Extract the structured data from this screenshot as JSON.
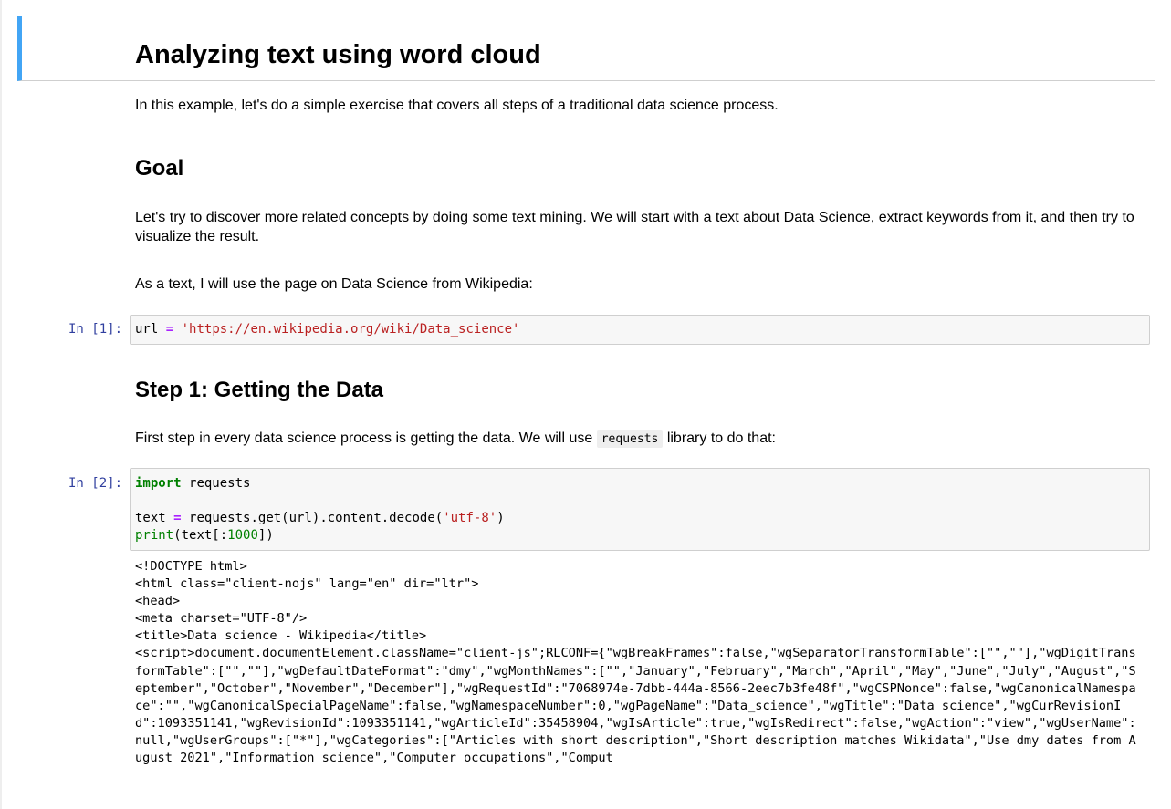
{
  "heading": "Analyzing text using word cloud",
  "intro": "In this example, let's do a simple exercise that covers all steps of a traditional data science process.",
  "goal": {
    "title": "Goal",
    "para1": "Let's try to discover more related concepts by doing some text mining. We will start with a text about Data Science, extract keywords from it, and then try to visualize the result.",
    "para2": "As a text, I will use the page on Data Science from Wikipedia:"
  },
  "cell1": {
    "prompt": "In [1]:",
    "var": "url",
    "op": "=",
    "value": "'https://en.wikipedia.org/wiki/Data_science'"
  },
  "step1": {
    "title": "Step 1: Getting the Data",
    "para_before": "First step in every data science process is getting the data. We will use",
    "inline_code": "requests",
    "para_after": "library to do that:"
  },
  "cell2": {
    "prompt": "In [2]:",
    "kw_import": "import",
    "module": "requests",
    "line2_var": "text",
    "line2_op": "=",
    "line2_call": "requests.get(url).content.decode(",
    "line2_str": "'utf-8'",
    "line2_close": ")",
    "line3_print": "print",
    "line3_a": "(text[:",
    "line3_num": "1000",
    "line3_b": "])",
    "output": "<!DOCTYPE html>\n<html class=\"client-nojs\" lang=\"en\" dir=\"ltr\">\n<head>\n<meta charset=\"UTF-8\"/>\n<title>Data science - Wikipedia</title>\n<script>document.documentElement.className=\"client-js\";RLCONF={\"wgBreakFrames\":false,\"wgSeparatorTransformTable\":[\"\",\"\"],\"wgDigitTransformTable\":[\"\",\"\"],\"wgDefaultDateFormat\":\"dmy\",\"wgMonthNames\":[\"\",\"January\",\"February\",\"March\",\"April\",\"May\",\"June\",\"July\",\"August\",\"September\",\"October\",\"November\",\"December\"],\"wgRequestId\":\"7068974e-7dbb-444a-8566-2eec7b3fe48f\",\"wgCSPNonce\":false,\"wgCanonicalNamespace\":\"\",\"wgCanonicalSpecialPageName\":false,\"wgNamespaceNumber\":0,\"wgPageName\":\"Data_science\",\"wgTitle\":\"Data science\",\"wgCurRevisionId\":1093351141,\"wgRevisionId\":1093351141,\"wgArticleId\":35458904,\"wgIsArticle\":true,\"wgIsRedirect\":false,\"wgAction\":\"view\",\"wgUserName\":null,\"wgUserGroups\":[\"*\"],\"wgCategories\":[\"Articles with short description\",\"Short description matches Wikidata\",\"Use dmy dates from August 2021\",\"Information science\",\"Computer occupations\",\"Comput"
  },
  "colors": {
    "heading_bar": "#42a5f5",
    "prompt": "#303f9f",
    "keyword": "#008000",
    "operator": "#aa22ff",
    "string": "#ba2121"
  }
}
